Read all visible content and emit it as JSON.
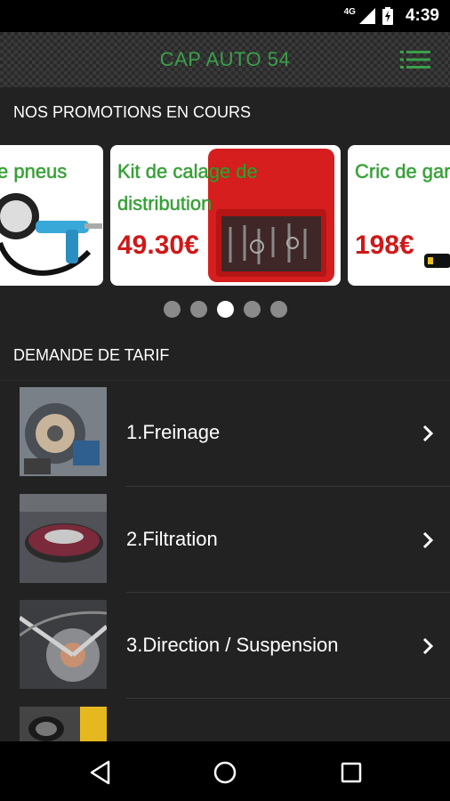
{
  "status_bar": {
    "network": "4G",
    "time": "4:39"
  },
  "app_bar": {
    "title": "CAP AUTO 54"
  },
  "promotions": {
    "header": "NOS PROMOTIONS EN COURS",
    "cards": [
      {
        "title": "e pneus",
        "price": ""
      },
      {
        "title": "Kit de calage de distribution",
        "price": "49.30€"
      },
      {
        "title": "Cric de gar tonnes",
        "price": "198€"
      }
    ],
    "active_page": 3,
    "page_count": 5
  },
  "tarif": {
    "header": "DEMANDE DE TARIF",
    "items": [
      {
        "label": "1.Freinage"
      },
      {
        "label": "2.Filtration"
      },
      {
        "label": "3.Direction / Suspension"
      },
      {
        "label": ""
      }
    ]
  },
  "colors": {
    "accent": "#3aa04a",
    "price": "#d01818",
    "background": "#222222"
  }
}
